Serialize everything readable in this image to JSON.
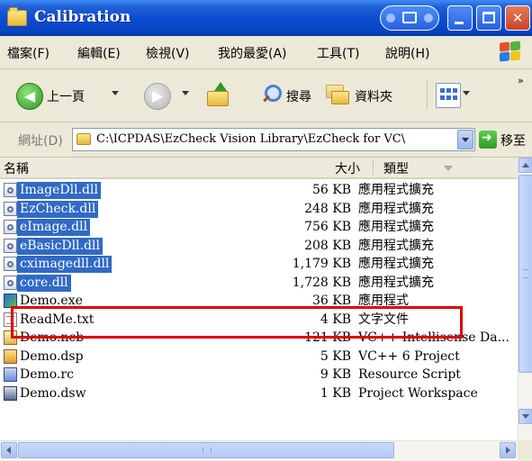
{
  "window": {
    "title": "Calibration"
  },
  "menu": [
    "檔案(F)",
    "編輯(E)",
    "檢視(V)",
    "我的最愛(A)",
    "工具(T)",
    "說明(H)"
  ],
  "toolbar": {
    "back_label": "上一頁",
    "search_label": "搜尋",
    "folders_label": "資料夾",
    "overflow": "»"
  },
  "address": {
    "label": "網址(D)",
    "path": "C:\\ICPDAS\\EzCheck Vision Library\\EzCheck for VC\\",
    "go_label": "移至"
  },
  "columns": {
    "name": "名稱",
    "size": "大小",
    "type": "類型"
  },
  "files": [
    {
      "name": "ImageDll.dll",
      "size": "56 KB",
      "type": "應用程式擴充",
      "icon": "dll-file-icon",
      "selected": true
    },
    {
      "name": "EzCheck.dll",
      "size": "248 KB",
      "type": "應用程式擴充",
      "icon": "dll-file-icon",
      "selected": true
    },
    {
      "name": "eImage.dll",
      "size": "756 KB",
      "type": "應用程式擴充",
      "icon": "dll-file-icon",
      "selected": true
    },
    {
      "name": "eBasicDll.dll",
      "size": "208 KB",
      "type": "應用程式擴充",
      "icon": "dll-file-icon",
      "selected": true
    },
    {
      "name": "cximagedll.dll",
      "size": "1,179 KB",
      "type": "應用程式擴充",
      "icon": "dll-file-icon",
      "selected": true
    },
    {
      "name": "core.dll",
      "size": "1,728 KB",
      "type": "應用程式擴充",
      "icon": "dll-file-icon",
      "selected": true
    },
    {
      "name": "Demo.exe",
      "size": "36 KB",
      "type": "應用程式",
      "icon": "exe-file-icon",
      "selected": false
    },
    {
      "name": "ReadMe.txt",
      "size": "4 KB",
      "type": "文字文件",
      "icon": "text-file-icon",
      "selected": false
    },
    {
      "name": "Demo.ncb",
      "size": "121 KB",
      "type": "VC++ Intellisense Da...",
      "icon": "ncb-file-icon",
      "selected": false
    },
    {
      "name": "Demo.dsp",
      "size": "5 KB",
      "type": "VC++ 6 Project",
      "icon": "dsp-file-icon",
      "selected": false
    },
    {
      "name": "Demo.rc",
      "size": "9 KB",
      "type": "Resource Script",
      "icon": "rc-file-icon",
      "selected": false
    },
    {
      "name": "Demo.dsw",
      "size": "1 KB",
      "type": "Project Workspace",
      "icon": "dsw-file-icon",
      "selected": false
    }
  ],
  "highlight": {
    "target": "Demo.exe",
    "color": "#e00000"
  },
  "colors": {
    "titlebar": "#0a4bd1",
    "selection": "#316ac5",
    "chrome": "#ece9d8"
  }
}
